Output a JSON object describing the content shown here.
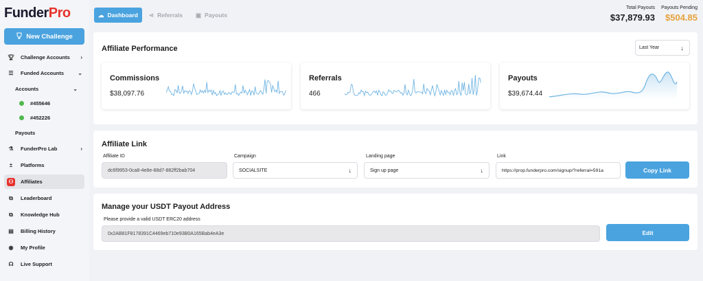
{
  "brand": {
    "name_a": "Funder",
    "name_b": "Pro"
  },
  "sidebar": {
    "new_challenge": "New Challenge",
    "items": [
      {
        "label": "Challenge Accounts",
        "icon": "trophy-icon"
      },
      {
        "label": "Funded Accounts",
        "icon": "list-icon"
      },
      {
        "label": "Accounts"
      },
      {
        "label": "#455646"
      },
      {
        "label": "#452226"
      },
      {
        "label": "Payouts"
      },
      {
        "label": "FunderPro Lab",
        "icon": "flask-icon"
      },
      {
        "label": "Platforms",
        "icon": "plus-minus-icon"
      },
      {
        "label": "Affiliates",
        "icon": "affiliates-icon"
      },
      {
        "label": "Leaderboard",
        "icon": "external-link-icon"
      },
      {
        "label": "Knowledge Hub",
        "icon": "external-link-icon"
      },
      {
        "label": "Billing History",
        "icon": "billing-icon"
      },
      {
        "label": "My Profile",
        "icon": "profile-icon"
      },
      {
        "label": "Live Support",
        "icon": "headset-icon"
      }
    ]
  },
  "tabs": [
    {
      "label": "Dashboard",
      "icon": "dashboard-icon"
    },
    {
      "label": "Referrals",
      "icon": "share-icon"
    },
    {
      "label": "Payouts",
      "icon": "payout-icon"
    }
  ],
  "totals": {
    "payouts_label": "Total Payouts",
    "payouts_value": "$37,879.93",
    "pending_label": "Payouts Pending",
    "pending_value": "$504.85",
    "pending_color": "#e6a23c"
  },
  "performance": {
    "title": "Affiliate Performance",
    "range": "Last Year",
    "cards": [
      {
        "title": "Commissions",
        "value": "$38,097.76"
      },
      {
        "title": "Referrals",
        "value": "466"
      },
      {
        "title": "Payouts",
        "value": "$39,674.44"
      }
    ]
  },
  "affiliate_link": {
    "title": "Affiliate Link",
    "id_label": "Affiliate ID",
    "id_value": "dc6f9953-0ca8-4e8e-88d7-882ff2bab704",
    "campaign_label": "Campaign",
    "campaign_value": "SOCIALSITE",
    "landing_label": "Landing page",
    "landing_value": "Sign up page",
    "link_label": "Link",
    "link_value": "https://prop.funderpro.com/signup/?referral=591a",
    "copy_button": "Copy Link"
  },
  "usdt": {
    "title": "Manage your USDT Payout Address",
    "hint": "Please provide a valid USDT ERC20 address",
    "address": "0x2AB81F8178391C4469eb710e93B0A165Bab4eA3e",
    "edit_button": "Edit"
  },
  "colors": {
    "accent": "#4aa3df",
    "brand_red": "#e5322d",
    "spark": "#6fb4e3"
  }
}
